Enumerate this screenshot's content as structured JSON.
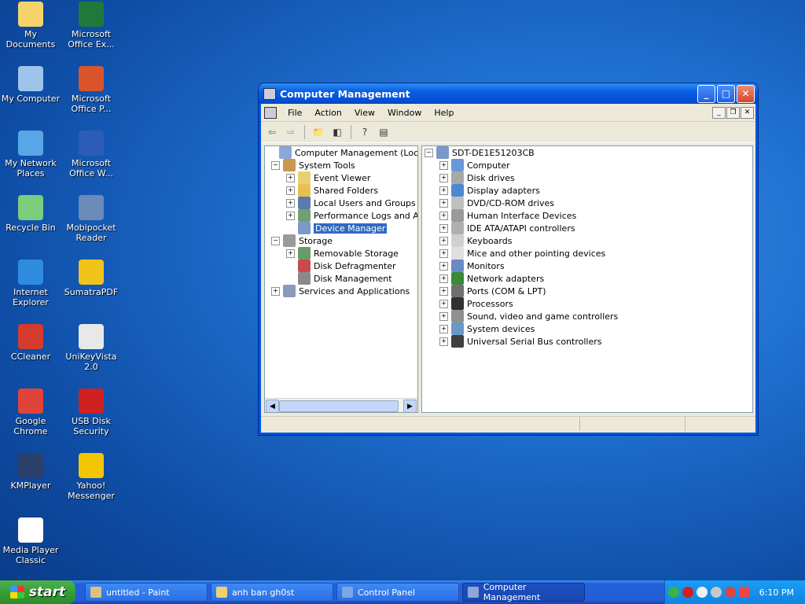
{
  "desktop": {
    "icons": [
      {
        "label": "My Documents",
        "icon": "my-documents-icon",
        "color": "#f5d36a"
      },
      {
        "label": "Microsoft Office Ex...",
        "icon": "excel-icon",
        "color": "#1f7a3a"
      },
      {
        "label": "My Computer",
        "icon": "my-computer-icon",
        "color": "#9fc3ea"
      },
      {
        "label": "Microsoft Office P...",
        "icon": "powerpoint-icon",
        "color": "#d9542b"
      },
      {
        "label": "My Network Places",
        "icon": "network-places-icon",
        "color": "#58a6e6"
      },
      {
        "label": "Microsoft Office W...",
        "icon": "word-icon",
        "color": "#2a5cb8"
      },
      {
        "label": "Recycle Bin",
        "icon": "recycle-bin-icon",
        "color": "#7ccd7c"
      },
      {
        "label": "Mobipocket Reader",
        "icon": "mobipocket-icon",
        "color": "#6b8bb8"
      },
      {
        "label": "Internet Explorer",
        "icon": "internet-explorer-icon",
        "color": "#2e8be0"
      },
      {
        "label": "SumatraPDF",
        "icon": "sumatrapdf-icon",
        "color": "#f0c419"
      },
      {
        "label": "CCleaner",
        "icon": "ccleaner-icon",
        "color": "#d33b2c"
      },
      {
        "label": "UniKeyVista 2.0",
        "icon": "unikey-icon",
        "color": "#e8e8e8"
      },
      {
        "label": "Google Chrome",
        "icon": "chrome-icon",
        "color": "#e0433a"
      },
      {
        "label": "USB Disk Security",
        "icon": "usb-security-icon",
        "color": "#d02020"
      },
      {
        "label": "KMPlayer",
        "icon": "kmplayer-icon",
        "color": "#2a3f6a"
      },
      {
        "label": "Yahoo! Messenger",
        "icon": "yahoo-messenger-icon",
        "color": "#f2c600"
      },
      {
        "label": "Media Player Classic",
        "icon": "media-player-classic-icon",
        "color": "#ffffff"
      }
    ]
  },
  "window": {
    "title": "Computer Management",
    "menu": [
      "File",
      "Action",
      "View",
      "Window",
      "Help"
    ],
    "tree_root": "Computer Management (Local)",
    "tree": [
      {
        "label": "System Tools",
        "level": 1,
        "exp": "-"
      },
      {
        "label": "Event Viewer",
        "level": 2,
        "exp": "+"
      },
      {
        "label": "Shared Folders",
        "level": 2,
        "exp": "+"
      },
      {
        "label": "Local Users and Groups",
        "level": 2,
        "exp": "+"
      },
      {
        "label": "Performance Logs and Alerts",
        "level": 2,
        "exp": "+"
      },
      {
        "label": "Device Manager",
        "level": 2,
        "exp": "",
        "selected": true
      },
      {
        "label": "Storage",
        "level": 1,
        "exp": "-"
      },
      {
        "label": "Removable Storage",
        "level": 2,
        "exp": "+"
      },
      {
        "label": "Disk Defragmenter",
        "level": 2,
        "exp": ""
      },
      {
        "label": "Disk Management",
        "level": 2,
        "exp": ""
      },
      {
        "label": "Services and Applications",
        "level": 1,
        "exp": "+"
      }
    ],
    "device_root": "SDT-DE1E51203CB",
    "devices": [
      "Computer",
      "Disk drives",
      "Display adapters",
      "DVD/CD-ROM drives",
      "Human Interface Devices",
      "IDE ATA/ATAPI controllers",
      "Keyboards",
      "Mice and other pointing devices",
      "Monitors",
      "Network adapters",
      "Ports (COM & LPT)",
      "Processors",
      "Sound, video and game controllers",
      "System devices",
      "Universal Serial Bus controllers"
    ]
  },
  "taskbar": {
    "start_label": "start",
    "tasks": [
      {
        "label": "untitled - Paint",
        "icon": "paint-icon",
        "active": false
      },
      {
        "label": "anh ban gh0st",
        "icon": "folder-icon",
        "active": false
      },
      {
        "label": "Control Panel",
        "icon": "control-panel-icon",
        "active": false
      },
      {
        "label": "Computer Management",
        "icon": "computer-management-icon",
        "active": true
      }
    ],
    "clock": "6:10 PM"
  }
}
